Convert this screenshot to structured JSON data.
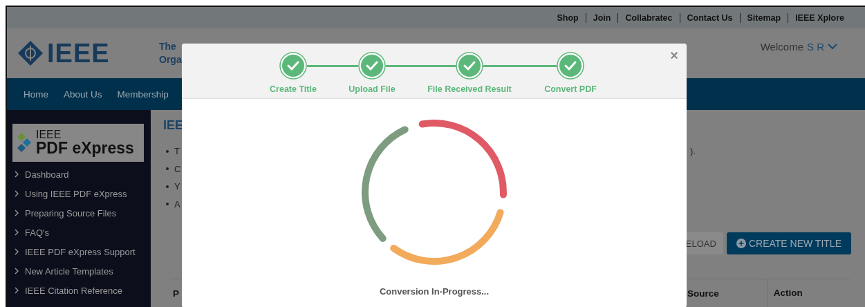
{
  "top_links": [
    "Shop",
    "Join",
    "Collabratec",
    "Contact Us",
    "Sitemap",
    "IEEE Xplore"
  ],
  "header": {
    "logo": "IEEE",
    "tagline_1": "The",
    "tagline_2": "Orga",
    "welcome": "Welcome",
    "user": "S R"
  },
  "nav": [
    "Home",
    "About Us",
    "Membership"
  ],
  "sidebar": {
    "logo_top": "IEEE",
    "logo_bottom": "PDF eXpress",
    "items": [
      "Dashboard",
      "Using IEEE PDF eXpress",
      "Preparing Source Files",
      "FAQ's",
      "IEEE PDF eXpress Support",
      "New Article Templates",
      "IEEE Citation Reference"
    ]
  },
  "content": {
    "heading": "IEE",
    "bullets": [
      "T",
      "C",
      "Y",
      "A"
    ],
    "bullet_tail": ").",
    "buttons": [
      {
        "label": "ELOAD",
        "kind": "secondary"
      },
      {
        "label": "CREATE NEW TITLE",
        "kind": "primary"
      }
    ],
    "table_columns": [
      "P",
      "Source",
      "Action"
    ]
  },
  "modal": {
    "close": "×",
    "steps": [
      {
        "label": "Create Title",
        "done": true
      },
      {
        "label": "Upload File",
        "done": true
      },
      {
        "label": "File Received Result",
        "done": true
      },
      {
        "label": "Convert PDF",
        "done": true
      }
    ],
    "status": "Conversion In-Progress..."
  }
}
